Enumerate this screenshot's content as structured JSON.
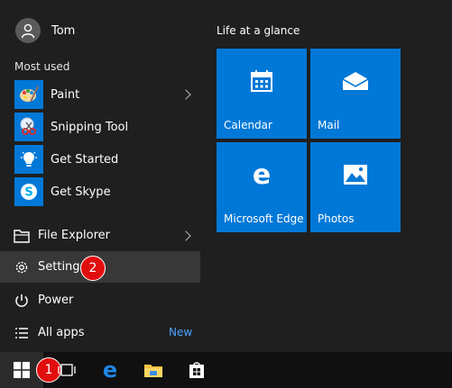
{
  "user": {
    "name": "Tom"
  },
  "most_used_label": "Most used",
  "most_used": [
    {
      "label": "Paint",
      "icon": "paint-icon",
      "has_submenu": true
    },
    {
      "label": "Snipping Tool",
      "icon": "snipping-tool-icon",
      "has_submenu": false
    },
    {
      "label": "Get Started",
      "icon": "get-started-icon",
      "has_submenu": false
    },
    {
      "label": "Get Skype",
      "icon": "skype-icon",
      "has_submenu": false
    }
  ],
  "system_items": {
    "file_explorer": "File Explorer",
    "settings": "Settings",
    "power": "Power",
    "all_apps": "All apps",
    "all_apps_badge": "New"
  },
  "tiles_heading": "Life at a glance",
  "tiles": [
    {
      "label": "Calendar",
      "icon": "calendar-icon"
    },
    {
      "label": "Mail",
      "icon": "mail-icon"
    },
    {
      "label": "Microsoft Edge",
      "icon": "edge-icon"
    },
    {
      "label": "Photos",
      "icon": "photos-icon"
    }
  ],
  "annotations": {
    "step1": "1",
    "step2": "2"
  },
  "colors": {
    "tile": "#0078d7",
    "start_bg": "#1f1f1f",
    "badge": "#e20d0d",
    "new_text": "#4aa3ff"
  }
}
